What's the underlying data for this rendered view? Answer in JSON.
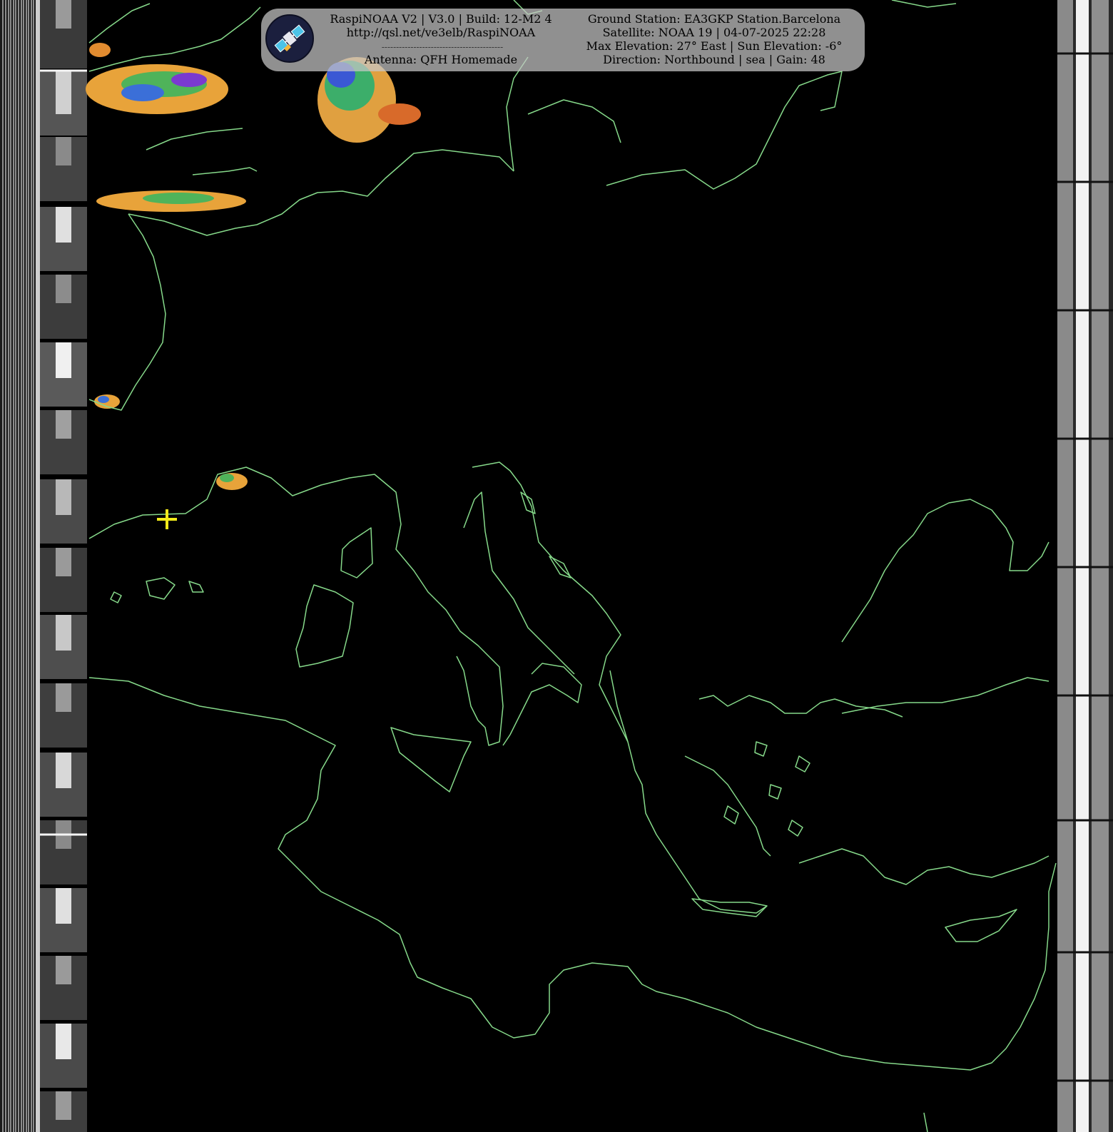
{
  "header": {
    "left_line1": "RaspiNOAA V2 | V3.0 | Build: 12-M2 4",
    "left_line2": "http://qsl.net/ve3elb/RaspiNOAA",
    "separator": "------------------------------------------",
    "left_line4": "Antenna: QFH Homemade",
    "right_line1": "Ground Station: EA3GKP Station.Barcelona",
    "right_line2": "Satellite: NOAA 19 | 04-07-2025 22:28",
    "right_line3": "Max Elevation: 27° East | Sun Elevation: -6°",
    "right_line4": "Direction: Northbound | sea | Gain: 48"
  },
  "logo": {
    "icon": "satellite-icon"
  },
  "map": {
    "region": "Europe and Mediterranean",
    "coastline_color": "#86d98a",
    "ground_station_marker_color": "#f2ea1a",
    "background_color": "#000000"
  }
}
